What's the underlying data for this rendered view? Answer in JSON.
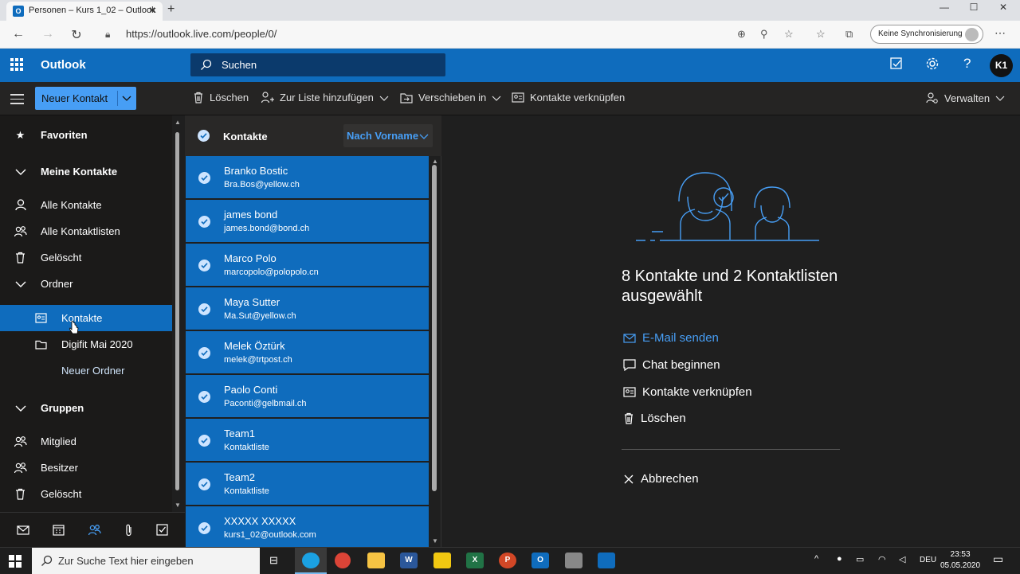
{
  "browser": {
    "tab_title": "Personen – Kurs 1_02 – Outlook",
    "tab_icon_letter": "O",
    "url": "https://outlook.live.com/people/0/",
    "sync_label": "Keine Synchronisierung"
  },
  "header": {
    "brand": "Outlook",
    "search_placeholder": "Suchen",
    "avatar_initials": "K1"
  },
  "commandbar": {
    "new_contact": "Neuer Kontakt",
    "delete": "Löschen",
    "add_to_list": "Zur Liste hinzufügen",
    "move_to": "Verschieben in",
    "link_contacts": "Kontakte verknüpfen",
    "manage": "Verwalten"
  },
  "sidebar": {
    "favorites": "Favoriten",
    "my_contacts": "Meine Kontakte",
    "all_contacts": "Alle Kontakte",
    "all_lists": "Alle Kontaktlisten",
    "deleted": "Gelöscht",
    "folders": "Ordner",
    "folder_contacts": "Kontakte",
    "folder_digifit": "Digifit Mai 2020",
    "new_folder": "Neuer Ordner",
    "groups": "Gruppen",
    "member": "Mitglied",
    "owner": "Besitzer",
    "groups_deleted": "Gelöscht"
  },
  "contact_list": {
    "title": "Kontakte",
    "sort_label": "Nach Vorname",
    "rows": [
      {
        "name": "Branko Bostic",
        "sub": "Bra.Bos@yellow.ch"
      },
      {
        "name": "james bond",
        "sub": "james.bond@bond.ch"
      },
      {
        "name": "Marco Polo",
        "sub": "marcopolo@polopolo.cn"
      },
      {
        "name": "Maya Sutter",
        "sub": "Ma.Sut@yellow.ch"
      },
      {
        "name": "Melek Öztürk",
        "sub": "melek@trtpost.ch"
      },
      {
        "name": "Paolo Conti",
        "sub": "Paconti@gelbmail.ch"
      },
      {
        "name": "Team1",
        "sub": "Kontaktliste"
      },
      {
        "name": "Team2",
        "sub": "Kontaktliste"
      },
      {
        "name": "XXXXX XXXXX",
        "sub": "kurs1_02@outlook.com"
      }
    ]
  },
  "reading_pane": {
    "summary": "8 Kontakte und 2 Kontaktlisten ausgewählt",
    "send_email": "E-Mail senden",
    "start_chat": "Chat beginnen",
    "link_contacts": "Kontakte verknüpfen",
    "delete": "Löschen",
    "cancel": "Abbrechen"
  },
  "taskbar": {
    "search_placeholder": "Zur Suche Text hier eingeben",
    "language": "DEU",
    "time": "23:53",
    "date": "05.05.2020"
  },
  "colors": {
    "accent": "#0f6cbd",
    "link": "#479ef5",
    "selection_text": "#cde4ff"
  }
}
